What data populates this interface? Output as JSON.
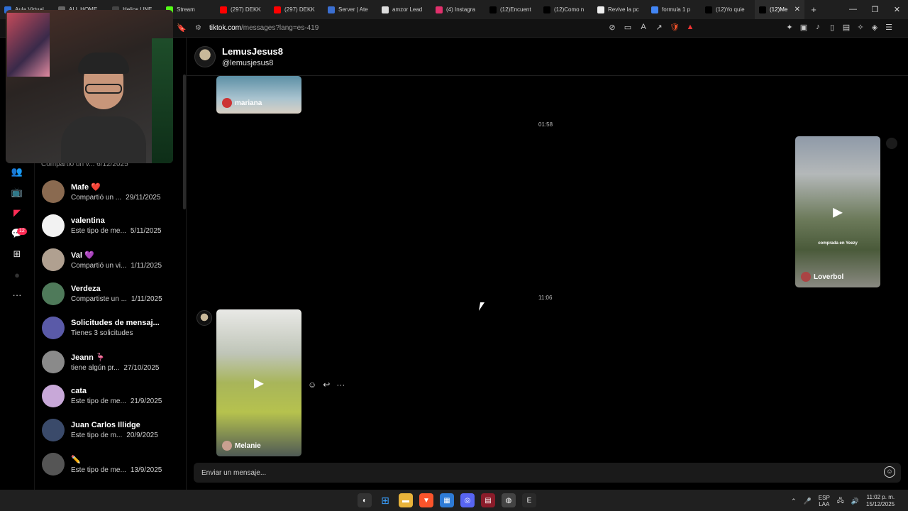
{
  "browser": {
    "tabs": [
      {
        "label": "Aula Virtual",
        "color": "#2f6fd6"
      },
      {
        "label": "ALL HOME",
        "color": "#666666"
      },
      {
        "label": "Helios UNE",
        "color": "#444444"
      },
      {
        "label": "Stream",
        "color": "#53fc18"
      },
      {
        "label": "(297) DEKK",
        "color": "#ff0000"
      },
      {
        "label": "(297) DEKK",
        "color": "#ff0000"
      },
      {
        "label": "Server | Ate",
        "color": "#3b6fd1"
      },
      {
        "label": "amzor Lead",
        "color": "#dddddd"
      },
      {
        "label": "(4) Instagra",
        "color": "#e1306c"
      },
      {
        "label": "(12)Encuent",
        "color": "#000000"
      },
      {
        "label": "(12)Como n",
        "color": "#000000"
      },
      {
        "label": "Revive la pc",
        "color": "#eeeeee"
      },
      {
        "label": "formula 1 p",
        "color": "#4285f4"
      },
      {
        "label": "(12)Yo quie",
        "color": "#000000"
      }
    ],
    "active_tab": {
      "label": "(12)Me",
      "color": "#000000"
    },
    "close_glyph": "✕",
    "new_tab_glyph": "+",
    "window_controls": {
      "minimize": "—",
      "maximize": "❐",
      "close": "✕"
    },
    "url_host": "tiktok.com",
    "url_path": "/messages?lang=es-419"
  },
  "rail": {
    "icons": [
      "people-icon",
      "live-icon",
      "tiktok-logo-icon",
      "inbox-icon",
      "upload-icon",
      "profile-dot-icon",
      "more-icon"
    ],
    "inbox_badge": "12"
  },
  "conversations": {
    "partial_preview": "Compartió un v...   6/12/2025",
    "items": [
      {
        "name": "Mafe ❤️",
        "preview": "Compartió un ...",
        "date": "29/11/2025",
        "avatar_color": "#8a6a50"
      },
      {
        "name": "valentina",
        "preview": "Este tipo de me...",
        "date": "5/11/2025",
        "avatar_color": "#f2f2f2"
      },
      {
        "name": "Val 💜",
        "preview": "Compartió un vi...",
        "date": "1/11/2025",
        "avatar_color": "#b0a090"
      },
      {
        "name": "Verdeza",
        "preview": "Compartiste un ...",
        "date": "1/11/2025",
        "avatar_color": "#4f7a5a"
      },
      {
        "name": "Solicitudes de mensaj...",
        "preview": "Tienes 3 solicitudes",
        "date": "",
        "avatar_color": "#5a5aa8"
      },
      {
        "name": "Jeann 🦩",
        "preview": "tiene algún pr...",
        "date": "27/10/2025",
        "avatar_color": "#8a8a8a"
      },
      {
        "name": "cata",
        "preview": "Este tipo de me...",
        "date": "21/9/2025",
        "avatar_color": "#c8a8d8"
      },
      {
        "name": "Juan Carlos Illidge",
        "preview": "Este tipo de m...",
        "date": "20/9/2025",
        "avatar_color": "#3a4a6a"
      },
      {
        "name": "✏️",
        "preview": "Este tipo de me...",
        "date": "13/9/2025",
        "avatar_color": "#555555"
      }
    ]
  },
  "chat": {
    "name": "LemusJesus8",
    "handle": "@lemusjesus8",
    "timestamps": [
      "01:58",
      "11:06"
    ],
    "shared_videos": [
      {
        "author": "mariana",
        "side": "received"
      },
      {
        "author": "Loverbol",
        "side": "sent",
        "overlay_text": "comprada en Yeezy"
      },
      {
        "author": "Melanie",
        "side": "received"
      }
    ],
    "message_actions": [
      "reaction-icon",
      "reply-icon",
      "more-icon"
    ],
    "composer_placeholder": "Enviar un mensaje...",
    "play_glyph": "▶"
  },
  "taskbar": {
    "icons": [
      "start-icon",
      "file-explorer-icon",
      "brave-icon",
      "store-icon",
      "discord-icon",
      "app-icon",
      "stream-app-icon",
      "epic-icon"
    ],
    "language": "ESP",
    "layout": "LAA",
    "time": "11:02 p. m.",
    "date": "15/12/2025"
  }
}
